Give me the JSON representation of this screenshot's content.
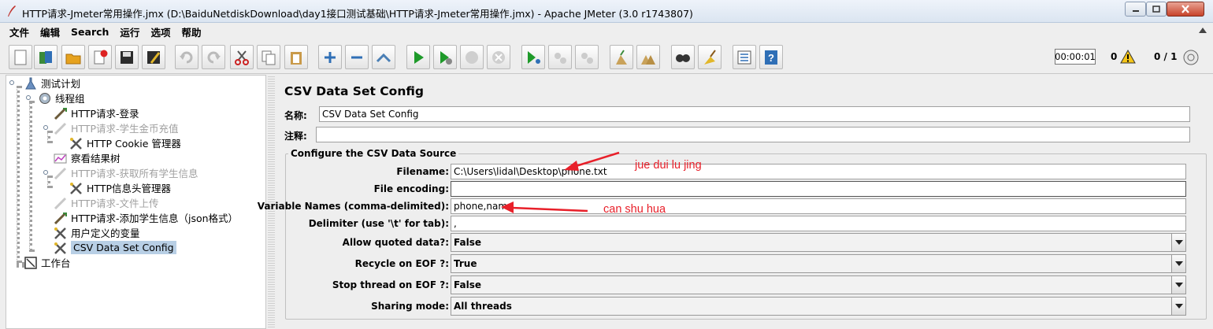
{
  "window": {
    "title": "HTTP请求-Jmeter常用操作.jmx (D:\\BaiduNetdiskDownload\\day1接口测试基础\\HTTP请求-Jmeter常用操作.jmx) - Apache JMeter (3.0 r1743807)"
  },
  "menu": [
    "文件",
    "编辑",
    "Search",
    "运行",
    "选项",
    "帮助"
  ],
  "toolbar": {
    "buttons": [
      "new-icon",
      "templates-icon",
      "open-icon",
      "close-file-icon",
      "save-icon",
      "save-as-icon",
      "undo-icon",
      "redo-icon",
      "cut-icon",
      "copy-icon",
      "paste-icon",
      "expand-icon",
      "collapse-icon",
      "toggle-icon",
      "start-icon",
      "start-no-pause-icon",
      "stop-icon",
      "shutdown-icon",
      "remote-start-icon",
      "remote-stop-icon",
      "remote-shutdown-icon",
      "clear-icon",
      "clear-all-icon",
      "search-icon",
      "reset-search-icon",
      "function-helper-icon",
      "help-icon"
    ],
    "timer": "00:00:01",
    "error_count": "0",
    "thread_count": "0 / 1"
  },
  "tree": {
    "items": [
      {
        "label": "测试计划",
        "disabled": false,
        "icon": "test-plan-icon"
      },
      {
        "label": "线程组",
        "disabled": false,
        "icon": "thread-group-icon"
      },
      {
        "label": "HTTP请求-登录",
        "disabled": false,
        "icon": "sampler-icon"
      },
      {
        "label": "HTTP请求-学生金币充值",
        "disabled": true,
        "icon": "sampler-icon"
      },
      {
        "label": "HTTP Cookie 管理器",
        "disabled": false,
        "icon": "config-icon"
      },
      {
        "label": "察看结果树",
        "disabled": false,
        "icon": "listener-icon"
      },
      {
        "label": "HTTP请求-获取所有学生信息",
        "disabled": true,
        "icon": "sampler-icon"
      },
      {
        "label": "HTTP信息头管理器",
        "disabled": false,
        "icon": "config-icon"
      },
      {
        "label": "HTTP请求-文件上传",
        "disabled": true,
        "icon": "sampler-icon"
      },
      {
        "label": "HTTP请求-添加学生信息（json格式）",
        "disabled": false,
        "icon": "sampler-icon"
      },
      {
        "label": "用户定义的变量",
        "disabled": false,
        "icon": "config-icon"
      },
      {
        "label": "CSV Data Set Config",
        "disabled": false,
        "icon": "config-icon",
        "selected": true
      },
      {
        "label": "工作台",
        "disabled": false,
        "icon": "workbench-icon"
      }
    ]
  },
  "panel": {
    "title": "CSV Data Set Config",
    "name_label": "名称:",
    "name_value": "CSV Data Set Config",
    "comment_label": "注释:",
    "comment_value": "",
    "section_title": "Configure the CSV Data Source",
    "fields": {
      "filename": {
        "label": "Filename:",
        "value": "C:\\Users\\lidal\\Desktop\\phone.txt"
      },
      "encoding": {
        "label": "File encoding:",
        "value": ""
      },
      "variables": {
        "label": "Variable Names (comma-delimited):",
        "value": "phone,name"
      },
      "delimiter": {
        "label": "Delimiter (use '\\t' for tab):",
        "value": ","
      }
    },
    "combos": {
      "quoted": {
        "label": "Allow quoted data?:",
        "value": "False"
      },
      "recycle": {
        "label": "Recycle on EOF ?:",
        "value": "True"
      },
      "stop": {
        "label": "Stop thread on EOF ?:",
        "value": "False"
      },
      "sharing": {
        "label": "Sharing mode:",
        "value": "All threads"
      }
    }
  },
  "annotations": {
    "filename_note": "jue dui lu jing",
    "variables_note": "can shu hua",
    "color": "#e8202a"
  }
}
